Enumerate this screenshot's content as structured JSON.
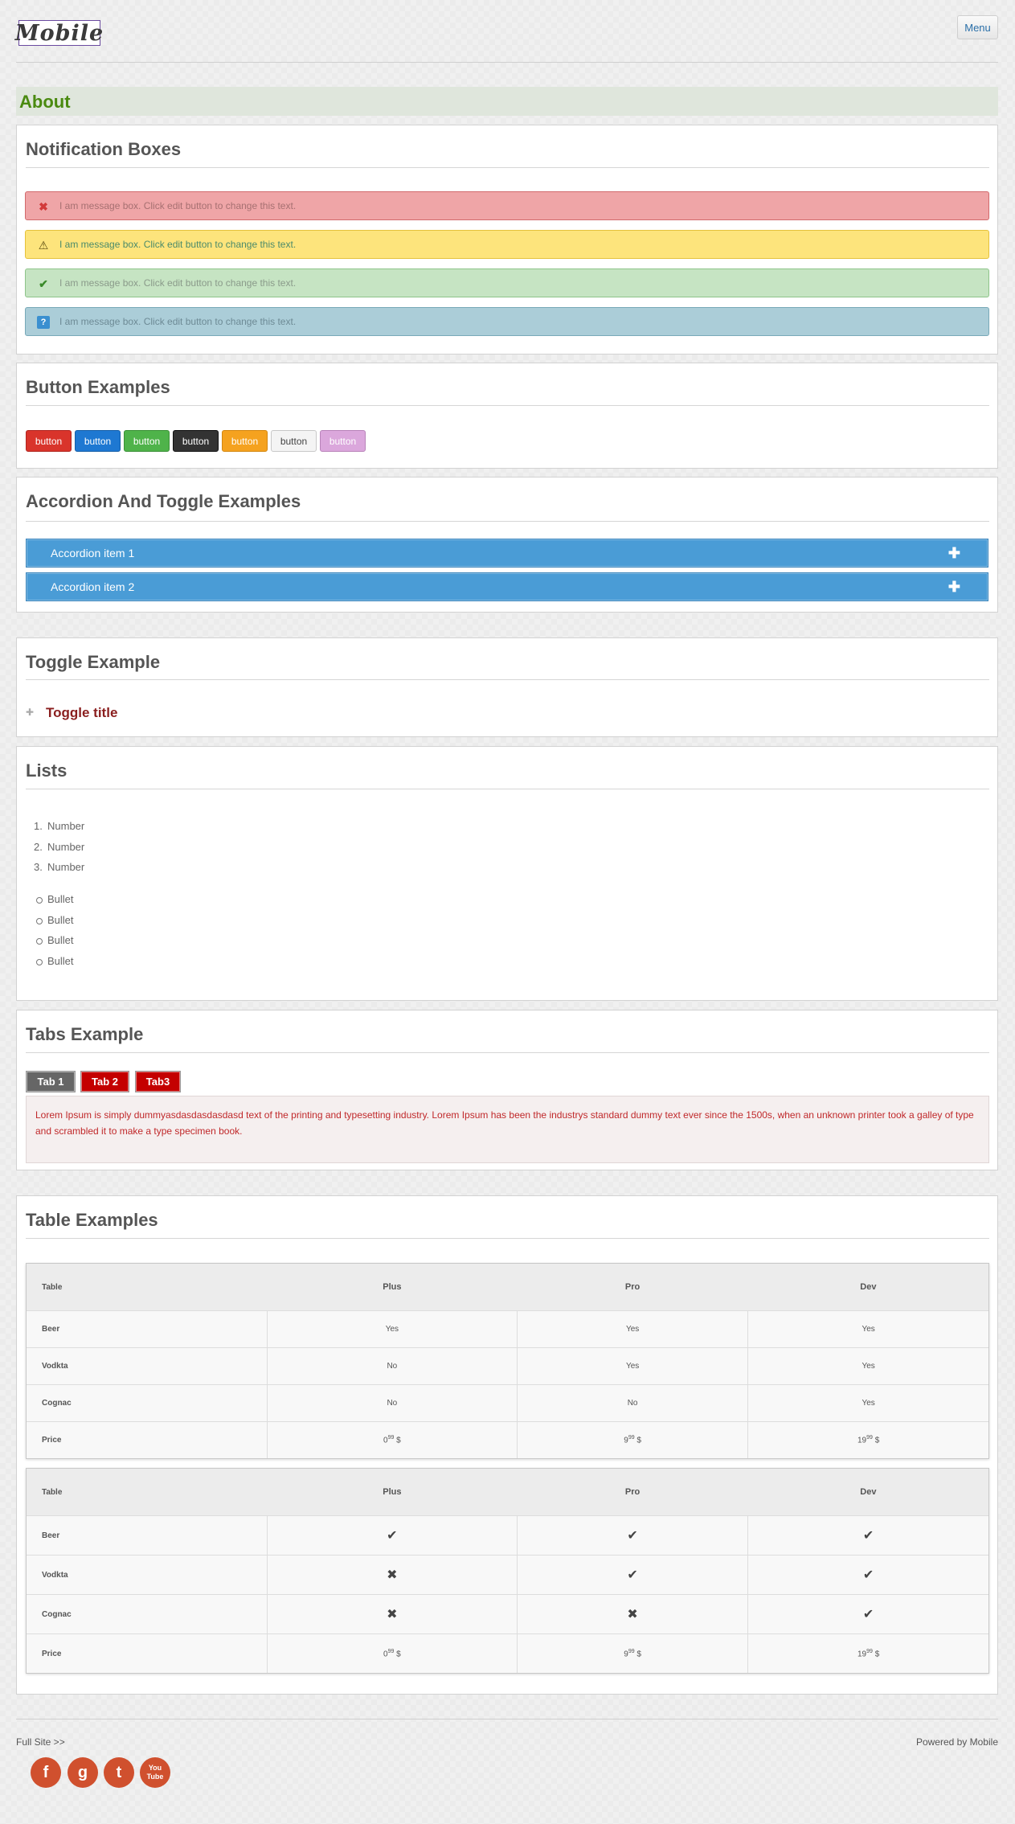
{
  "header": {
    "logo_text": "Mobile",
    "menu_label": "Menu"
  },
  "about": {
    "title": "About"
  },
  "notifications": {
    "title": "Notification Boxes",
    "boxes": [
      {
        "type": "error",
        "icon": "error-x-icon",
        "text": "I am message box. Click edit button to change this text."
      },
      {
        "type": "warning",
        "icon": "warning-icon",
        "text": "I am message box. Click edit button to change this text."
      },
      {
        "type": "success",
        "icon": "checkmark-icon",
        "text": "I am message box. Click edit button to change this text."
      },
      {
        "type": "info",
        "icon": "question-icon",
        "text": "I am message box. Click edit button to change this text."
      }
    ]
  },
  "buttons": {
    "title": "Button Examples",
    "items": [
      {
        "label": "button",
        "color": "#d9342b"
      },
      {
        "label": "button",
        "color": "#1e78d2"
      },
      {
        "label": "button",
        "color": "#4fb34a"
      },
      {
        "label": "button",
        "color": "#333333"
      },
      {
        "label": "button",
        "color": "#f5a21f"
      },
      {
        "label": "button",
        "color": "#f2f2f2"
      },
      {
        "label": "button",
        "color": "#dba7dc"
      }
    ]
  },
  "accordion": {
    "title": "Accordion And Toggle Examples",
    "items": [
      {
        "label": "Accordion item 1"
      },
      {
        "label": "Accordion item 2"
      }
    ]
  },
  "toggle": {
    "title": "Toggle Example",
    "item_label": "Toggle title"
  },
  "lists": {
    "title": "Lists",
    "ordered": [
      "Number",
      "Number",
      "Number"
    ],
    "bullets": [
      "Bullet",
      "Bullet",
      "Bullet",
      "Bullet"
    ]
  },
  "tabs": {
    "title": "Tabs Example",
    "items": [
      {
        "label": "Tab 1"
      },
      {
        "label": "Tab 2"
      },
      {
        "label": "Tab3"
      }
    ],
    "content": "Lorem Ipsum is simply dummyasdasdasdasdasd text of the printing and typesetting industry. Lorem Ipsum has been the industrys standard dummy text ever since the 1500s, when an unknown printer took a galley of type and scrambled it to make a type specimen book."
  },
  "tables": {
    "title": "Table Examples",
    "headers": [
      "Table",
      "Plus",
      "Pro",
      "Dev"
    ],
    "table1": [
      [
        "Beer",
        "Yes",
        "Yes",
        "Yes"
      ],
      [
        "Vodkta",
        "No",
        "Yes",
        "Yes"
      ],
      [
        "Cognac",
        "No",
        "No",
        "Yes"
      ]
    ],
    "table2_rows": [
      "Beer",
      "Vodkta",
      "Cognac"
    ],
    "price_label": "Price",
    "prices": [
      {
        "main": "0",
        "sup": "99",
        "currency": "$"
      },
      {
        "main": "9",
        "sup": "99",
        "currency": "$"
      },
      {
        "main": "19",
        "sup": "99",
        "currency": "$"
      }
    ]
  },
  "footer": {
    "full_site": "Full Site >>",
    "powered": "Powered by Mobile",
    "social": [
      {
        "icon": "facebook-icon",
        "glyph": "f"
      },
      {
        "icon": "google-icon",
        "glyph": "g"
      },
      {
        "icon": "twitter-icon",
        "glyph": "t"
      },
      {
        "icon": "youtube-icon",
        "glyph": "You Tube"
      }
    ]
  }
}
